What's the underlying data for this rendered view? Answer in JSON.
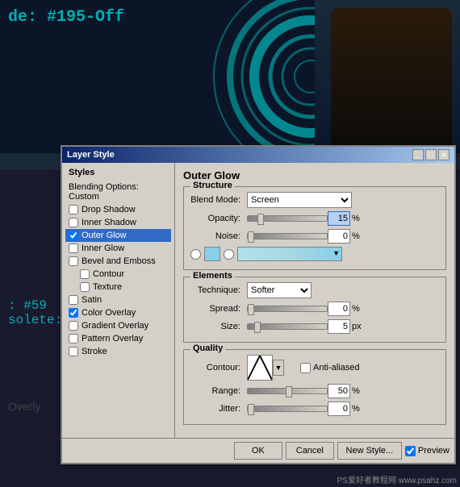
{
  "background": {
    "text1": "de: #195-Off",
    "text2": ": #59",
    "text3": "solete:"
  },
  "overlay_text": "Overly",
  "dialog": {
    "title": "Layer Style",
    "titlebar_buttons": [
      "_",
      "□",
      "×"
    ],
    "left_panel": {
      "header": "Styles",
      "items": [
        {
          "label": "Blending Options: Custom",
          "checked": false,
          "active": false,
          "type": "text"
        },
        {
          "label": "Drop Shadow",
          "checked": false,
          "active": false,
          "type": "checkbox"
        },
        {
          "label": "Inner Shadow",
          "checked": false,
          "active": false,
          "type": "checkbox"
        },
        {
          "label": "Outer Glow",
          "checked": true,
          "active": true,
          "type": "checkbox"
        },
        {
          "label": "Inner Glow",
          "checked": false,
          "active": false,
          "type": "checkbox"
        },
        {
          "label": "Bevel and Emboss",
          "checked": false,
          "active": false,
          "type": "checkbox"
        },
        {
          "label": "Contour",
          "checked": false,
          "active": false,
          "type": "checkbox",
          "indent": true
        },
        {
          "label": "Texture",
          "checked": false,
          "active": false,
          "type": "checkbox",
          "indent": true
        },
        {
          "label": "Satin",
          "checked": false,
          "active": false,
          "type": "checkbox"
        },
        {
          "label": "Color Overlay",
          "checked": true,
          "active": false,
          "type": "checkbox"
        },
        {
          "label": "Gradient Overlay",
          "checked": false,
          "active": false,
          "type": "checkbox"
        },
        {
          "label": "Pattern Overlay",
          "checked": false,
          "active": false,
          "type": "checkbox"
        },
        {
          "label": "Stroke",
          "checked": false,
          "active": false,
          "type": "checkbox"
        }
      ]
    },
    "right_panel": {
      "section_title": "Outer Glow",
      "structure": {
        "label": "Structure",
        "blend_mode_label": "Blend Mode:",
        "blend_mode_value": "Screen",
        "opacity_label": "Opacity:",
        "opacity_value": "15",
        "opacity_unit": "%",
        "noise_label": "Noise:",
        "noise_value": "0",
        "noise_unit": "%"
      },
      "elements": {
        "label": "Elements",
        "technique_label": "Technique:",
        "technique_value": "Softer",
        "spread_label": "Spread:",
        "spread_value": "0",
        "spread_unit": "%",
        "size_label": "Size:",
        "size_value": "5",
        "size_unit": "px"
      },
      "quality": {
        "label": "Quality",
        "contour_label": "Contour:",
        "anti_alias_label": "Anti-aliased",
        "range_label": "Range:",
        "range_value": "50",
        "range_unit": "%",
        "jitter_label": "Jitter:",
        "jitter_value": "0",
        "jitter_unit": "%"
      }
    },
    "footer": {
      "ok_label": "OK",
      "cancel_label": "Cancel",
      "new_style_label": "New Style...",
      "preview_label": "Preview"
    }
  },
  "watermark": "PS爱好者教程网 www.psahz.com"
}
